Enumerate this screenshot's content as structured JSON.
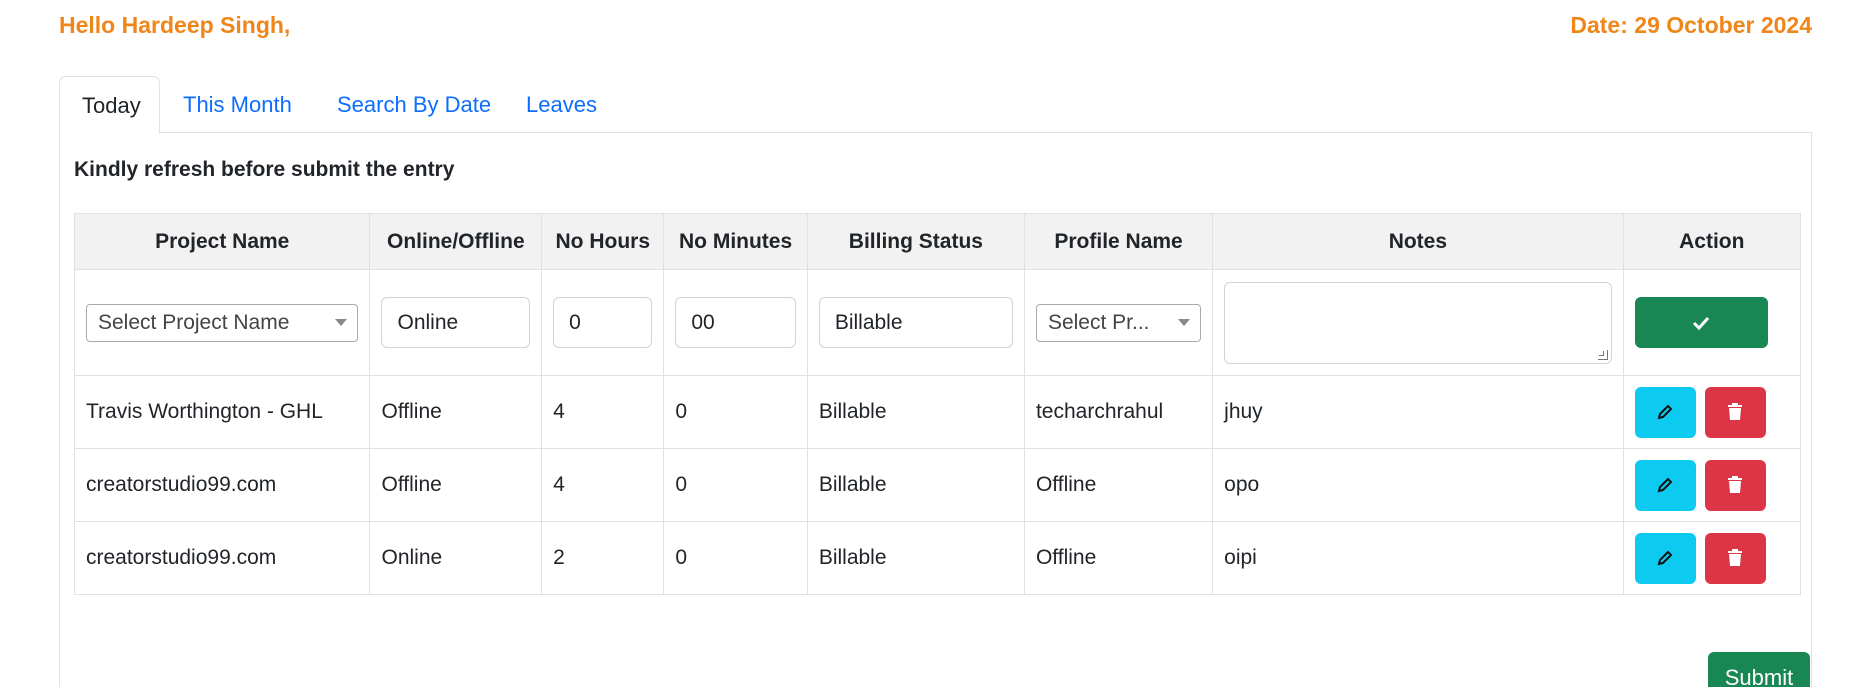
{
  "header": {
    "greeting": "Hello Hardeep Singh,",
    "date": "Date: 29 October 2024"
  },
  "tabs": [
    {
      "label": "Today",
      "active": true
    },
    {
      "label": "This Month",
      "active": false
    },
    {
      "label": "Search By Date",
      "active": false
    },
    {
      "label": "Leaves",
      "active": false
    }
  ],
  "notice": "Kindly refresh before submit the entry",
  "table": {
    "headers": [
      "Project Name",
      "Online/Offline",
      "No Hours",
      "No Minutes",
      "Billing Status",
      "Profile Name",
      "Notes",
      "Action"
    ],
    "entry": {
      "project_placeholder": "Select Project Name",
      "mode": "Online",
      "hours": "0",
      "minutes": "00",
      "billing": "Billable",
      "profile_placeholder": "Select Pr...",
      "notes": ""
    },
    "rows": [
      {
        "project": "Travis Worthington - GHL",
        "mode": "Offline",
        "hours": "4",
        "minutes": "0",
        "billing": "Billable",
        "profile": "techarchrahul",
        "notes": "jhuy"
      },
      {
        "project": "creatorstudio99.com",
        "mode": "Offline",
        "hours": "4",
        "minutes": "0",
        "billing": "Billable",
        "profile": "Offline",
        "notes": "opo"
      },
      {
        "project": "creatorstudio99.com",
        "mode": "Online",
        "hours": "2",
        "minutes": "0",
        "billing": "Billable",
        "profile": "Offline",
        "notes": "oipi"
      }
    ]
  },
  "submit_label": "Submit",
  "colors": {
    "accent": "#f0861a",
    "link": "#0d6efd",
    "success": "#198754",
    "info": "#0dcaf0",
    "danger": "#dc3545"
  },
  "icons": {
    "confirm": "check-icon",
    "edit": "pencil-icon",
    "delete": "trash-icon"
  }
}
